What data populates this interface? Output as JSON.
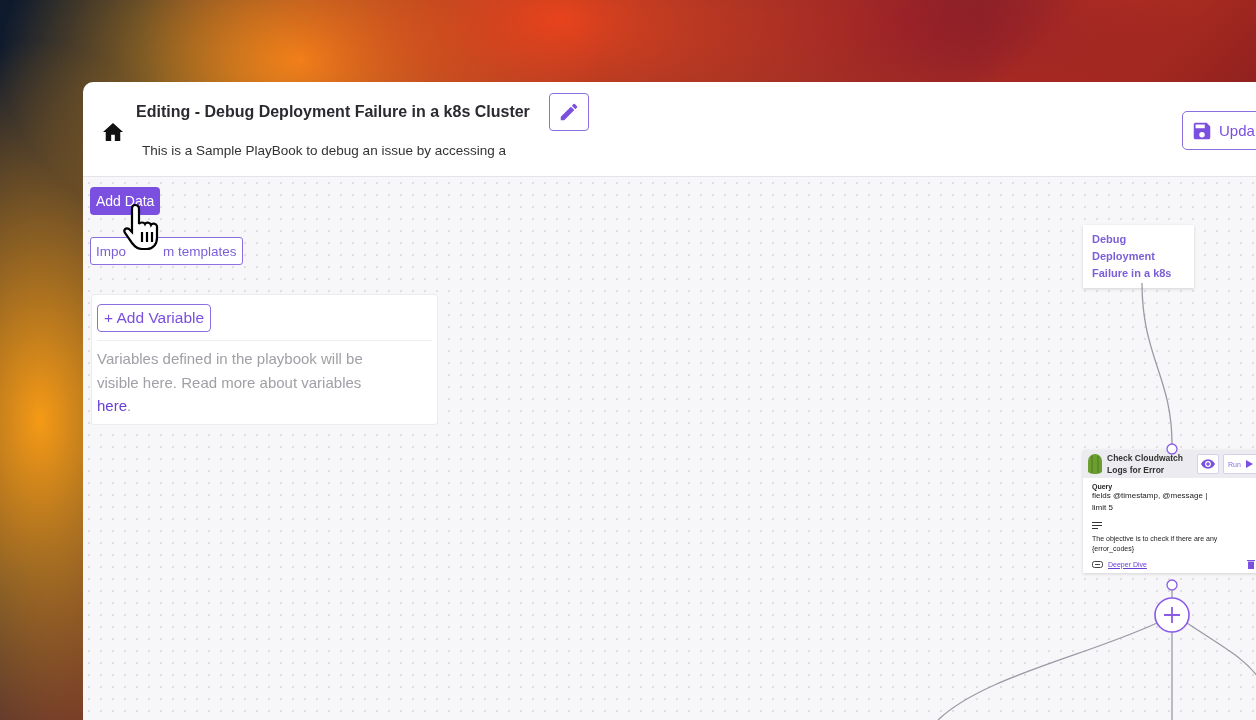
{
  "window": {
    "title": "Editing - Debug Deployment Failure in a k8s Cluster",
    "description": "This is a Sample PlayBook to debug an issue by accessing a",
    "update_button": "Upda"
  },
  "toolbar": {
    "add_data_button": "Add Data",
    "import_button_parts": [
      "Impo",
      "m templates"
    ]
  },
  "variables_panel": {
    "add_button": "+ Add Variable",
    "help_text": "Variables defined in the playbook will be visible here. Read more about variables ",
    "help_link": "here",
    "help_end": "."
  },
  "canvas": {
    "nodes": [
      {
        "kind": "title",
        "text": "Debug Deployment Failure in a k8s"
      },
      {
        "kind": "step",
        "title": "Check Cloudwatch Logs for Error",
        "run_button": "Run",
        "query_label": "Query",
        "query_lines": [
          "fields @timestamp, @message |",
          "limit 5"
        ],
        "description": "The objective is to check if there are any {error_codes}",
        "link": "Deeper Dive"
      }
    ]
  }
}
